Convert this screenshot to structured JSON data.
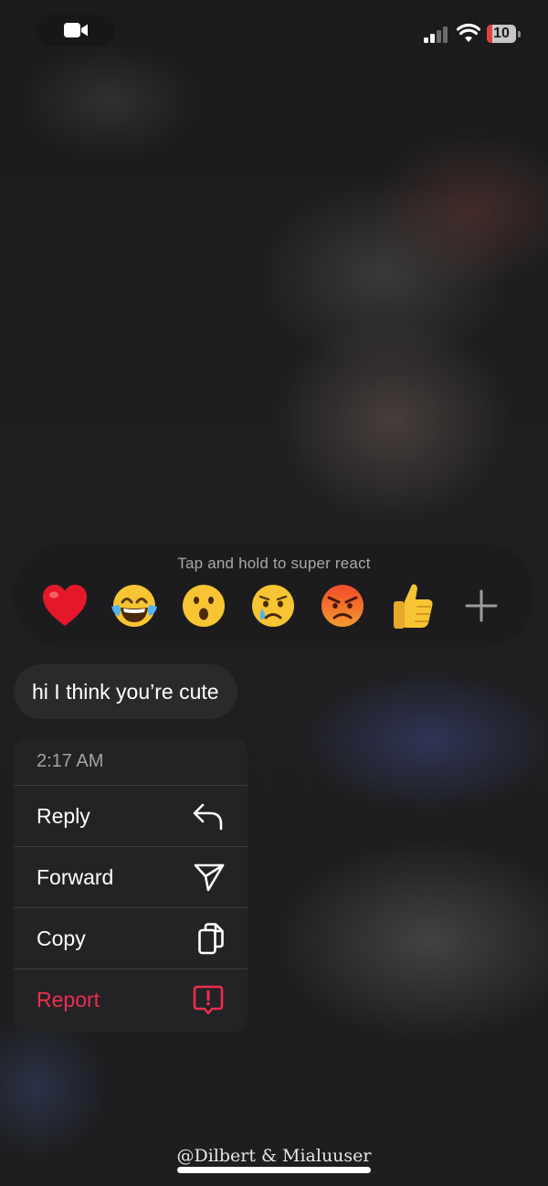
{
  "status_bar": {
    "camera_icon": "video-camera-icon",
    "signal_icon": "cellular-signal-icon",
    "wifi_icon": "wifi-icon",
    "battery_level": "10",
    "battery_color": "#e0423c"
  },
  "reactions": {
    "hint": "Tap and hold to super react",
    "emojis": [
      {
        "name": "red-heart",
        "char": "❤️"
      },
      {
        "name": "face-with-tears-of-joy",
        "char": "😂"
      },
      {
        "name": "face-with-open-mouth",
        "char": "😮"
      },
      {
        "name": "crying-face",
        "char": "😢"
      },
      {
        "name": "angry-face",
        "char": "😡"
      },
      {
        "name": "thumbs-up",
        "char": "👍"
      }
    ],
    "more_icon": "plus-icon"
  },
  "message": {
    "text": "hi I think you’re cute"
  },
  "context_menu": {
    "timestamp": "2:17 AM",
    "items": [
      {
        "label": "Reply",
        "icon": "reply-arrow-icon"
      },
      {
        "label": "Forward",
        "icon": "send-paper-plane-icon"
      },
      {
        "label": "Copy",
        "icon": "copy-icon"
      },
      {
        "label": "Report",
        "icon": "report-exclamation-icon",
        "color": "#ee2e4e"
      }
    ]
  },
  "footer": {
    "watermark": "@Dilbert & Mialuuser"
  }
}
